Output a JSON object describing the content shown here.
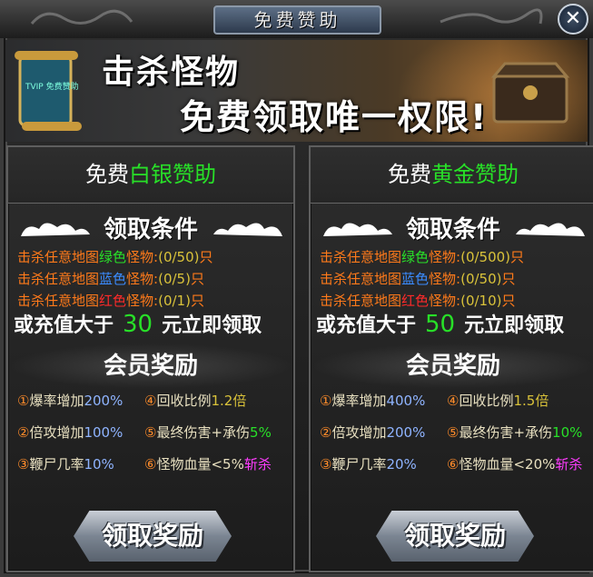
{
  "window": {
    "title": "免费赞助",
    "close_label": "✕"
  },
  "banner": {
    "line1": "击杀怪物",
    "line2": "免费领取唯一权限!",
    "scroll_text": "TVIP 免费赞助"
  },
  "panels": [
    {
      "head_prefix": "免费",
      "head_highlight": "白银赞助",
      "cond_title": "领取条件",
      "conditions": [
        {
          "prefix": "击杀任意地图",
          "color_word": "绿色",
          "suffix": "怪物:",
          "progress": "(0/50)",
          "unit": "只"
        },
        {
          "prefix": "击杀任意地图",
          "color_word": "蓝色",
          "suffix": "怪物:",
          "progress": "(0/5)",
          "unit": "只"
        },
        {
          "prefix": "击杀任意地图",
          "color_word": "红色",
          "suffix": "怪物:",
          "progress": "(0/1)",
          "unit": "只"
        }
      ],
      "recharge": {
        "prefix": "或充值大于",
        "amount": "30",
        "suffix": "元立即领取"
      },
      "reward_title": "会员奖励",
      "rewards": [
        {
          "num": "①",
          "label": "爆率增加",
          "value": "200%"
        },
        {
          "num": "④",
          "label": "回收比例",
          "value": "1.2倍"
        },
        {
          "num": "②",
          "label": "倍攻增加",
          "value": "100%"
        },
        {
          "num": "⑤",
          "label": "最终伤害+承伤",
          "value": "5%"
        },
        {
          "num": "③",
          "label": "鞭尸几率",
          "value": "10%"
        },
        {
          "num": "⑥",
          "label": "怪物血量<5%",
          "value": "斩杀"
        }
      ],
      "claim_label": "领取奖励"
    },
    {
      "head_prefix": "免费",
      "head_highlight": "黄金赞助",
      "cond_title": "领取条件",
      "conditions": [
        {
          "prefix": "击杀任意地图",
          "color_word": "绿色",
          "suffix": "怪物:",
          "progress": "(0/500)",
          "unit": "只"
        },
        {
          "prefix": "击杀任意地图",
          "color_word": "蓝色",
          "suffix": "怪物:",
          "progress": "(0/50)",
          "unit": "只"
        },
        {
          "prefix": "击杀任意地图",
          "color_word": "红色",
          "suffix": "怪物:",
          "progress": "(0/10)",
          "unit": "只"
        }
      ],
      "recharge": {
        "prefix": "或充值大于",
        "amount": "50",
        "suffix": "元立即领取"
      },
      "reward_title": "会员奖励",
      "rewards": [
        {
          "num": "①",
          "label": "爆率增加",
          "value": "400%"
        },
        {
          "num": "④",
          "label": "回收比例",
          "value": "1.5倍"
        },
        {
          "num": "②",
          "label": "倍攻增加",
          "value": "200%"
        },
        {
          "num": "⑤",
          "label": "最终伤害+承伤",
          "value": "10%"
        },
        {
          "num": "③",
          "label": "鞭尸几率",
          "value": "20%"
        },
        {
          "num": "⑥",
          "label": "怪物血量<20%",
          "value": "斩杀"
        }
      ],
      "claim_label": "领取奖励"
    }
  ],
  "colors": {
    "green": "#28e028",
    "blue": "#3b8cff",
    "red": "#ff2a2a",
    "orange": "#ff7a1a",
    "magenta": "#ff3cff"
  },
  "icons": {
    "close": "close-icon",
    "scroll": "scroll-icon",
    "box": "treasure-box-icon",
    "cloud": "cloud-ornament-icon"
  }
}
